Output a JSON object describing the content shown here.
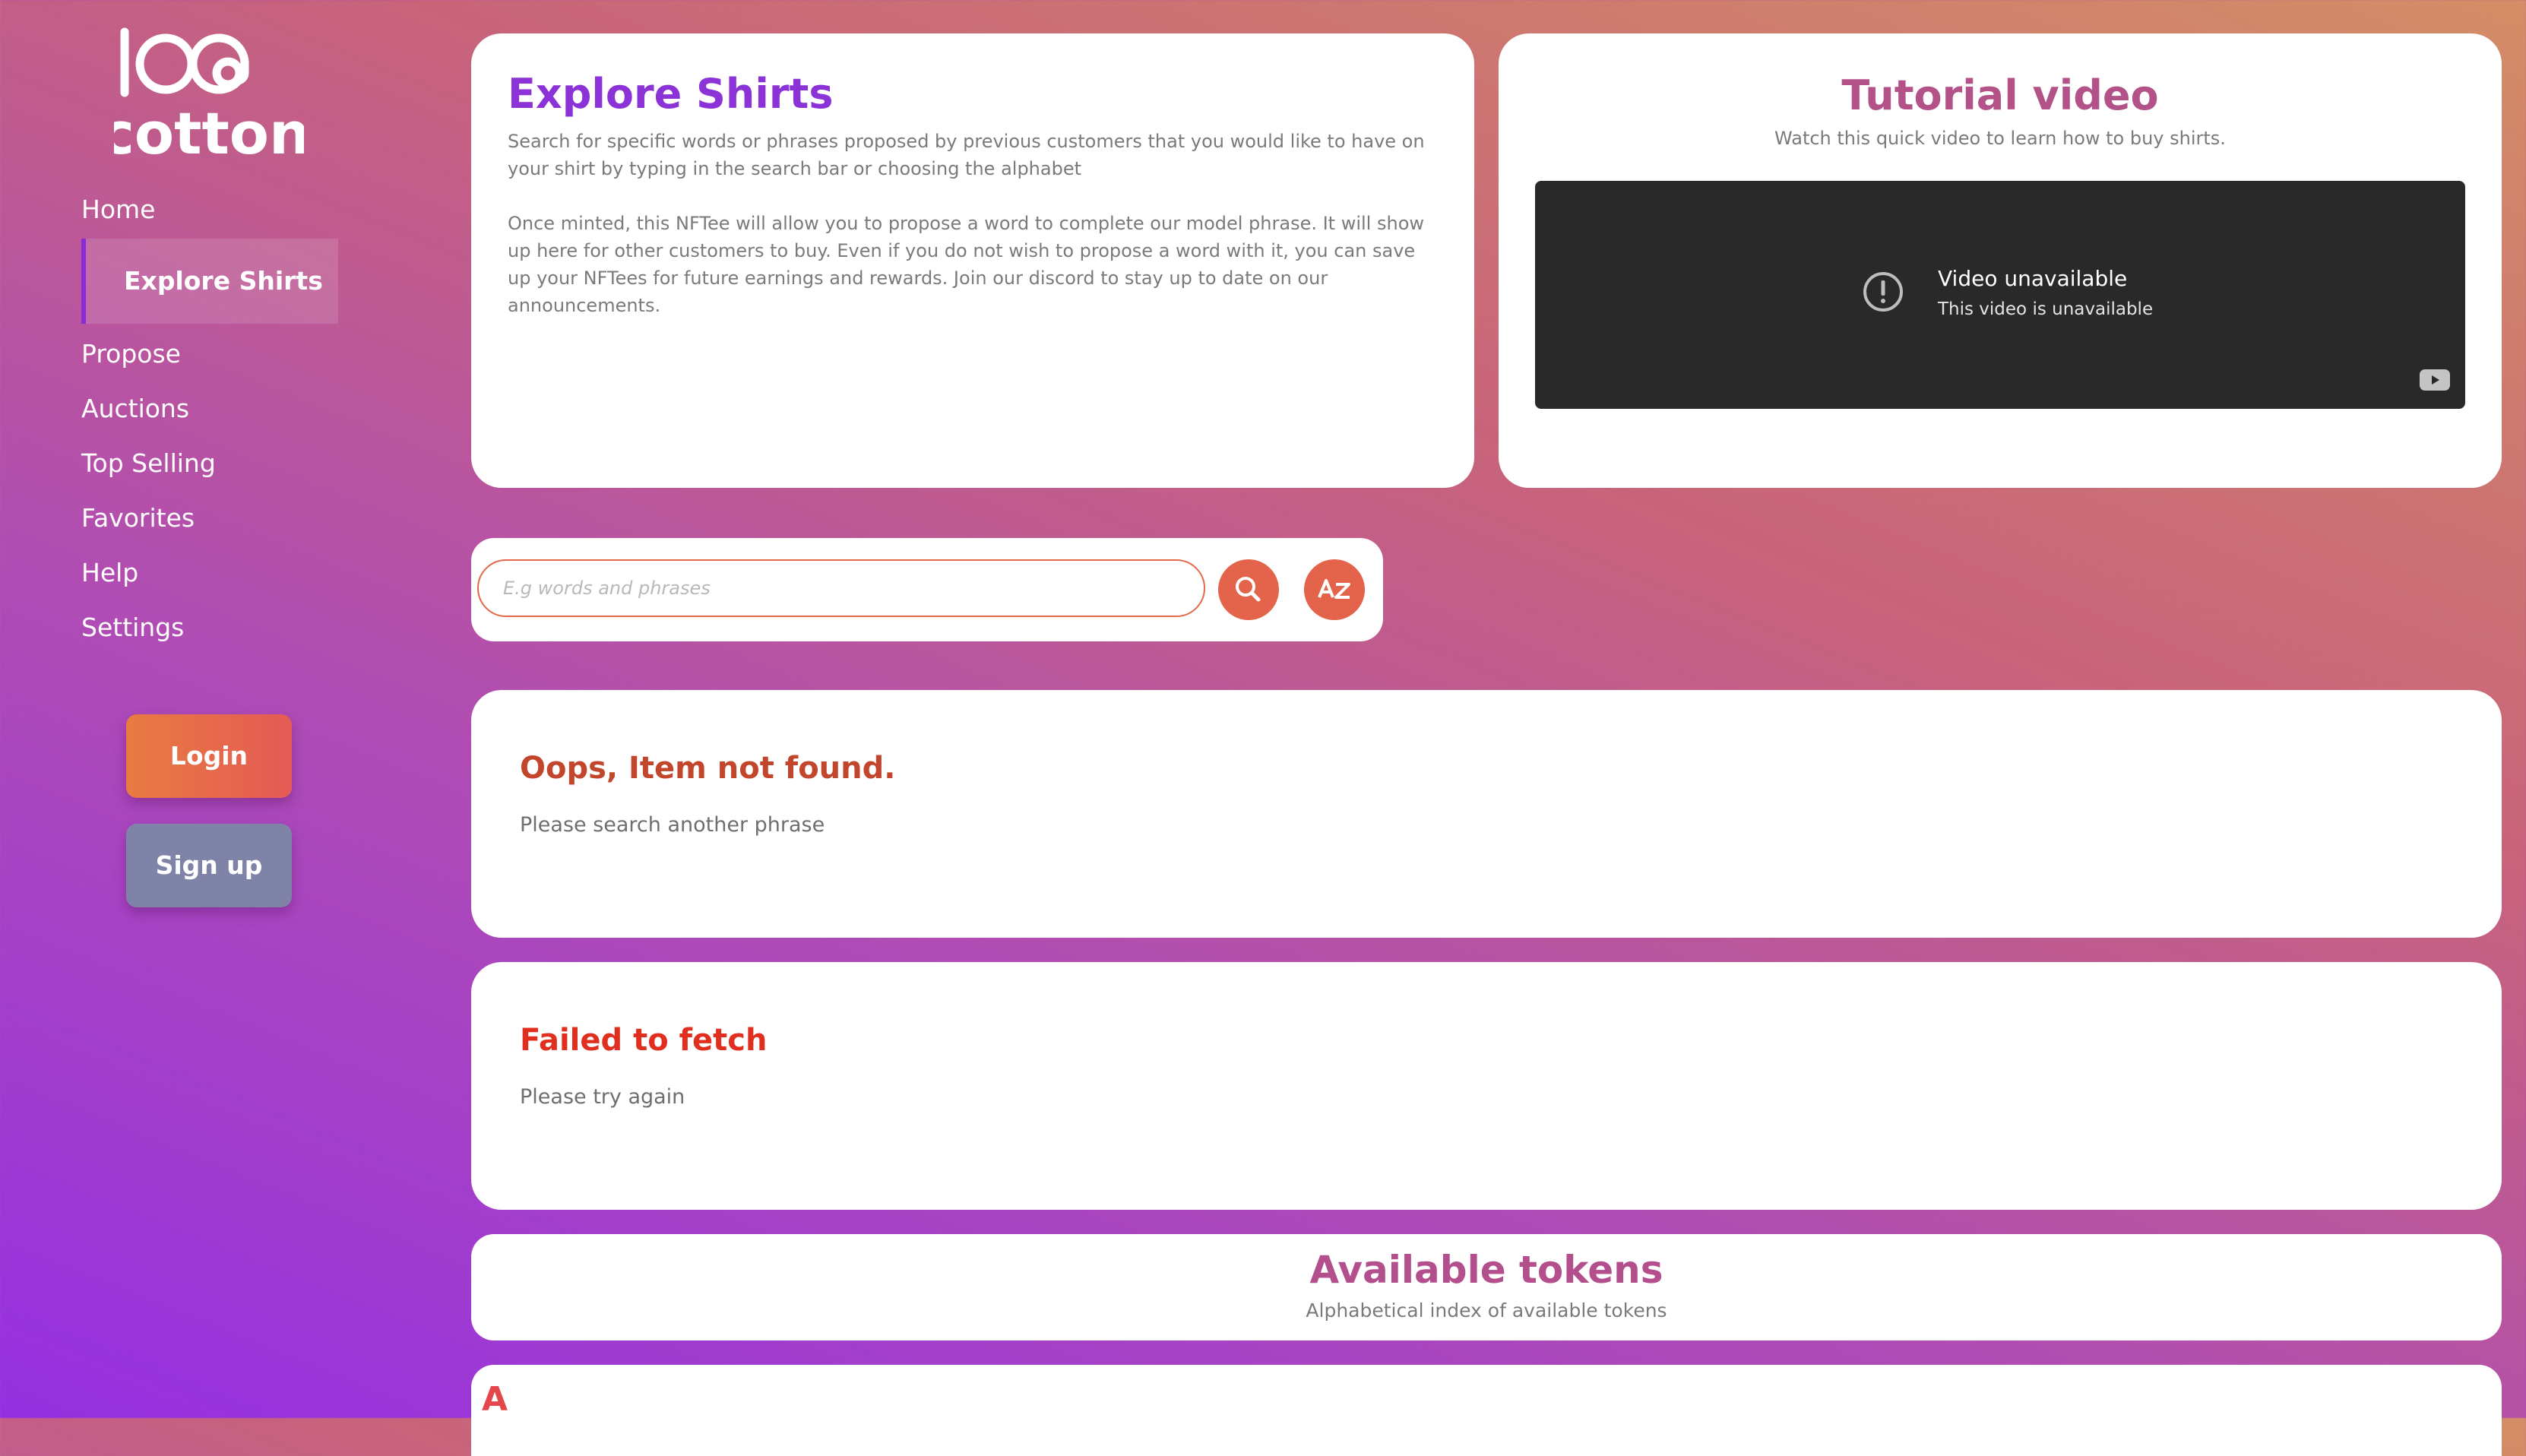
{
  "brand": {
    "logo_line1": "100",
    "logo_line2": "cotton"
  },
  "sidebar": {
    "items": [
      {
        "label": "Home"
      },
      {
        "label": "Explore Shirts",
        "active": true
      },
      {
        "label": "Propose"
      },
      {
        "label": "Auctions"
      },
      {
        "label": "Top Selling"
      },
      {
        "label": "Favorites"
      },
      {
        "label": "Help"
      },
      {
        "label": "Settings"
      }
    ],
    "login_label": "Login",
    "signup_label": "Sign up"
  },
  "explore": {
    "title": "Explore Shirts",
    "paragraph1": "Search for specific words or phrases proposed by previous customers that you would like to have on your shirt by typing in the search bar or choosing the alphabet",
    "paragraph2": "Once minted, this NFTee will allow you to propose a word to complete our model phrase. It will show up here for other customers to buy. Even if you do not wish to propose a word with it, you can save up your NFTees for future earnings and rewards. Join our discord to stay up to date on our announcements."
  },
  "tutorial": {
    "title": "Tutorial video",
    "subtitle": "Watch this quick video to learn how to buy shirts.",
    "player_message": "Video unavailable",
    "player_detail": "This video is unavailable"
  },
  "search": {
    "placeholder": "E.g words and phrases",
    "value": "",
    "search_icon": "search-icon",
    "az_icon": "alphabet-sort-icon"
  },
  "errors": {
    "not_found_title": "Oops, Item not found.",
    "not_found_text": "Please search another phrase",
    "fetch_title": "Failed to fetch",
    "fetch_text": "Please try again"
  },
  "tokens": {
    "title": "Available tokens",
    "subtitle": "Alphabetical index of available tokens",
    "first_letter": "A"
  },
  "colors": {
    "accent_purple": "#8b33d6",
    "accent_orange": "#e4644b",
    "error_red": "#e02f1e",
    "tokens_pink": "#b34f8c"
  }
}
